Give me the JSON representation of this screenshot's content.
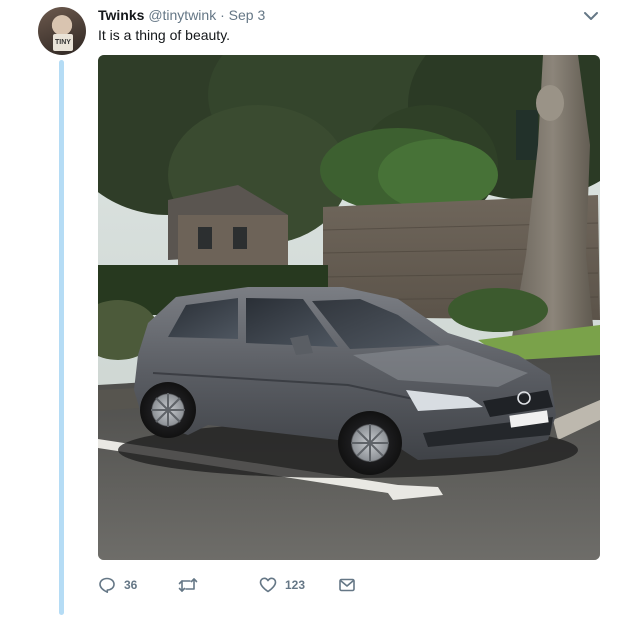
{
  "tweet": {
    "author_name": "Twinks",
    "author_handle": "@tinytwink",
    "separator": "·",
    "date": "Sep 3",
    "text": "It is a thing of beauty.",
    "avatar_mug_text": "TINY",
    "media_alt": "Grey Volkswagen Golf hatchback parked in a parking bay beside a stone wall and trees"
  },
  "actions": {
    "reply_count": "36",
    "retweet_count": "",
    "like_count": "123"
  },
  "icons": {
    "caret": "chevron-down-icon",
    "reply": "reply-icon",
    "retweet": "retweet-icon",
    "like": "heart-icon",
    "message": "envelope-icon"
  },
  "colors": {
    "thread_line": "#b5dcf5",
    "secondary_text": "#657786",
    "primary_text": "#14171a"
  }
}
